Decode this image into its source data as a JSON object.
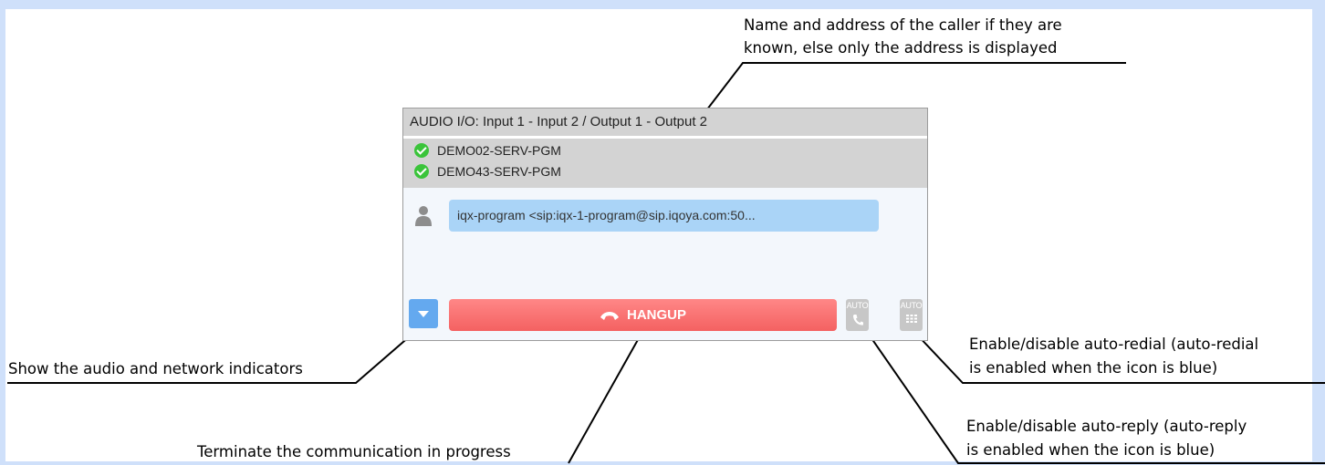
{
  "panel": {
    "header": "AUDIO I/O: Input 1 - Input 2 / Output 1 - Output 2",
    "codecs": [
      "DEMO02-SERV-PGM",
      "DEMO43-SERV-PGM"
    ],
    "caller": "iqx-program <sip:iqx-1-program@sip.iqoya.com:50...",
    "hangup_label": "HANGUP",
    "auto_redial_label": "AUTO",
    "auto_reply_label": "AUTO"
  },
  "callouts": {
    "caller_line1": "Name and address of the caller if they are",
    "caller_line2": "known, else only the address is displayed",
    "indicators": "Show the audio and network indicators",
    "hangup": "Terminate the communication in progress",
    "redial_line1": "Enable/disable auto-redial (auto-redial",
    "redial_line2": "is enabled when the icon is blue)",
    "reply_line1": "Enable/disable auto-reply (auto-reply",
    "reply_line2": "is enabled when the icon is blue)"
  },
  "colors": {
    "frame": "#cfe0fa",
    "panel_header": "#d3d3d3",
    "caller_field": "#aad4f7",
    "toggle_button": "#64a9ef",
    "hangup_button": "#f46161",
    "auto_disabled": "#c7c7c7",
    "status_ok": "#3ac43a"
  },
  "icons": {
    "codec_status": "check-circle-icon",
    "caller": "user-icon",
    "toggle": "triangle-down-icon",
    "hangup": "phone-hangup-icon",
    "auto_reply": "phone-icon",
    "auto_redial": "keypad-icon"
  }
}
